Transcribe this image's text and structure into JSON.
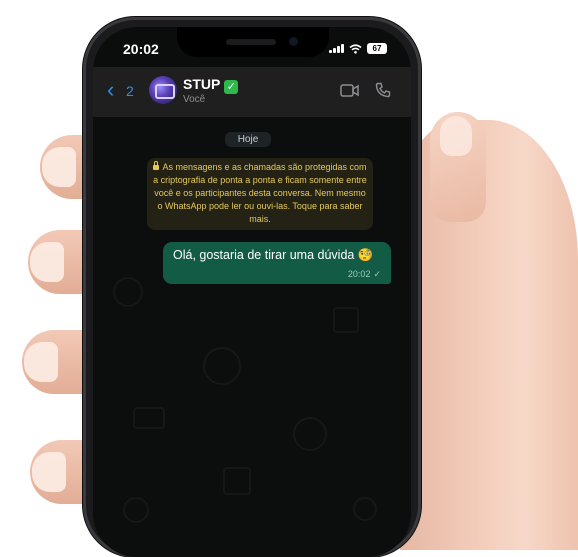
{
  "status_bar": {
    "time": "20:02",
    "battery": "67"
  },
  "header": {
    "back_count": "2",
    "contact_name": "STUP",
    "contact_subtitle": "Você",
    "verified_badge": "✓"
  },
  "chat": {
    "date_divider": "Hoje",
    "encryption_notice": "As mensagens e as chamadas são protegidas com a criptografia de ponta a ponta e ficam somente entre você e os participantes desta conversa. Nem mesmo o WhatsApp pode ler ou ouvi-las. Toque para saber mais.",
    "messages": [
      {
        "text": "Olá, gostaria de tirar uma dúvida 🧐",
        "time": "20:02",
        "status": "✓"
      }
    ]
  },
  "colors": {
    "outgoing_bubble": "#125c46",
    "encryption_text": "#e5c95c",
    "link_blue": "#2f8fe8"
  },
  "icons": [
    "back-chevron-icon",
    "video-call-icon",
    "voice-call-icon",
    "lock-icon",
    "sent-check-icon",
    "verified-icon"
  ]
}
